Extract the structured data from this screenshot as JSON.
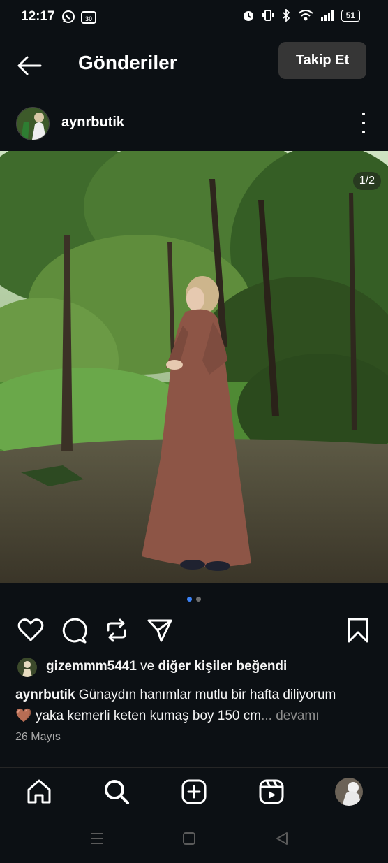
{
  "status_bar": {
    "time": "12:17",
    "battery": "51",
    "left_icons": [
      "whatsapp-icon",
      "speed-30-icon"
    ],
    "right_icons": [
      "alarm-icon",
      "vibrate-icon",
      "bluetooth-icon",
      "wifi-icon",
      "signal-icon",
      "battery-icon"
    ]
  },
  "header": {
    "title": "Gönderiler",
    "follow_label": "Takip Et"
  },
  "post": {
    "author": "aynrbutik",
    "counter": "1/2",
    "liked_by_user": "gizemmm5441",
    "liked_by_mid": " ve ",
    "liked_by_rest": "diğer kişiler beğendi",
    "caption_author": "aynrbutik",
    "caption_line1": " Günaydın hanımlar mutlu bir hafta diliyorum",
    "caption_emoji": "🤎",
    "caption_line2": " yaka kemerli  keten kumaş boy 150 cm",
    "caption_more": "... devamı",
    "date": "26 Mayıs",
    "slides": 2,
    "active_slide": 1
  },
  "colors": {
    "background": "#0c1014",
    "follow_button": "#363636",
    "active_dot": "#3b82f6",
    "muted_text": "#8e8e8e"
  }
}
